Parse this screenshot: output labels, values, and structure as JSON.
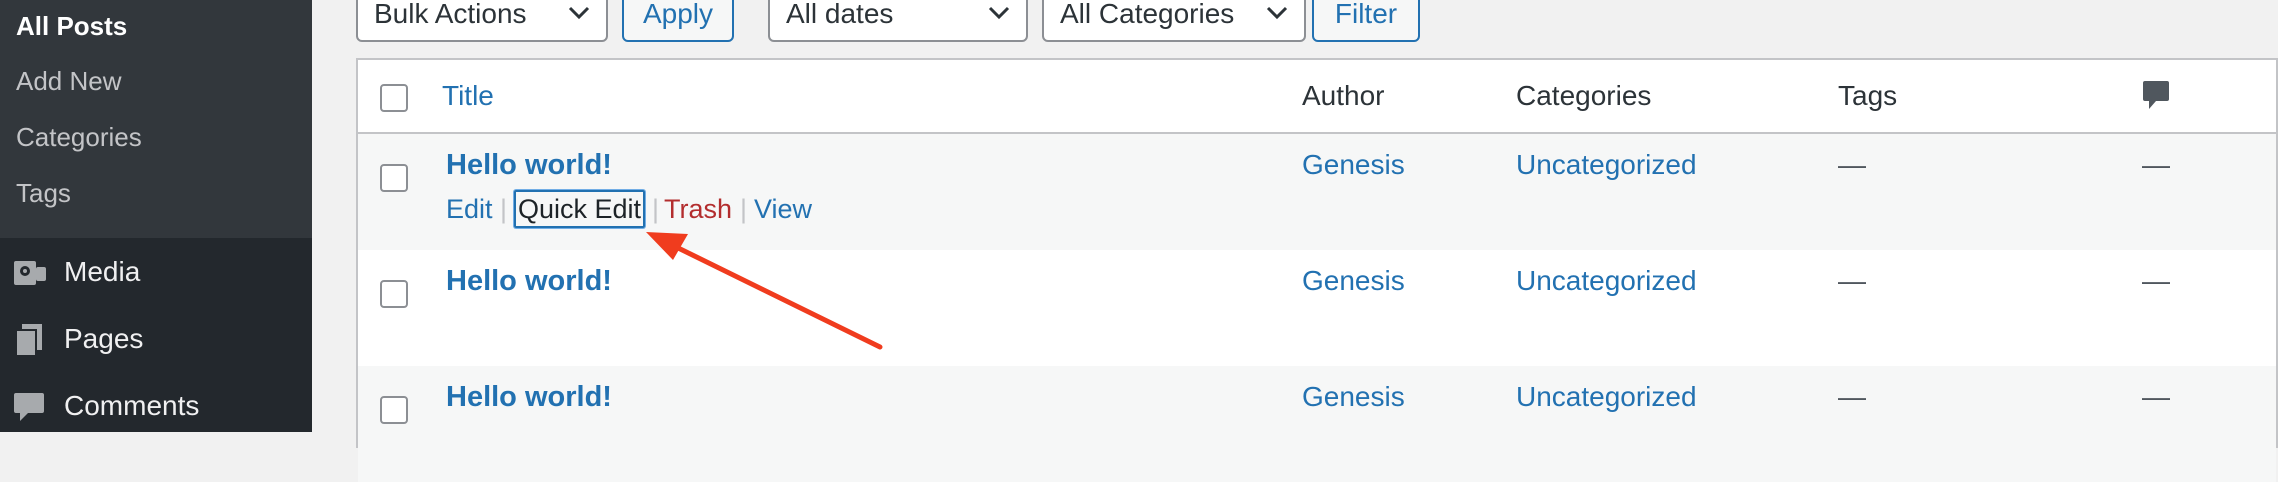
{
  "sidebar": {
    "submenu": [
      {
        "label": "All Posts",
        "current": true
      },
      {
        "label": "Add New"
      },
      {
        "label": "Categories"
      },
      {
        "label": "Tags"
      }
    ],
    "menu": [
      {
        "label": "Media",
        "icon": "media-icon"
      },
      {
        "label": "Pages",
        "icon": "pages-icon"
      },
      {
        "label": "Comments",
        "icon": "comments-icon"
      }
    ]
  },
  "tablenav": {
    "bulk_actions": "Bulk Actions",
    "apply": "Apply",
    "dates": "All dates",
    "categories": "All Categories",
    "filter": "Filter"
  },
  "table": {
    "headers": {
      "title": "Title",
      "author": "Author",
      "categories": "Categories",
      "tags": "Tags",
      "comments_icon": "comment-bubble-icon"
    },
    "rows": [
      {
        "title": "Hello world!",
        "author": "Genesis",
        "category": "Uncategorized",
        "tags": "—",
        "comments": "—"
      },
      {
        "title": "Hello world!",
        "author": "Genesis",
        "category": "Uncategorized",
        "tags": "—",
        "comments": "—"
      },
      {
        "title": "Hello world!",
        "author": "Genesis",
        "category": "Uncategorized",
        "tags": "—",
        "comments": "—"
      }
    ],
    "row_actions": {
      "edit": "Edit",
      "quick_edit": "Quick Edit",
      "trash": "Trash",
      "view": "View",
      "separator": "|"
    }
  },
  "annotation": {
    "color": "#f03c1e",
    "points_to": "quick-edit-link"
  },
  "colors": {
    "link": "#2271b1",
    "trash": "#b32d2e",
    "sidebar": "#23282d",
    "submenu": "#32373c"
  }
}
